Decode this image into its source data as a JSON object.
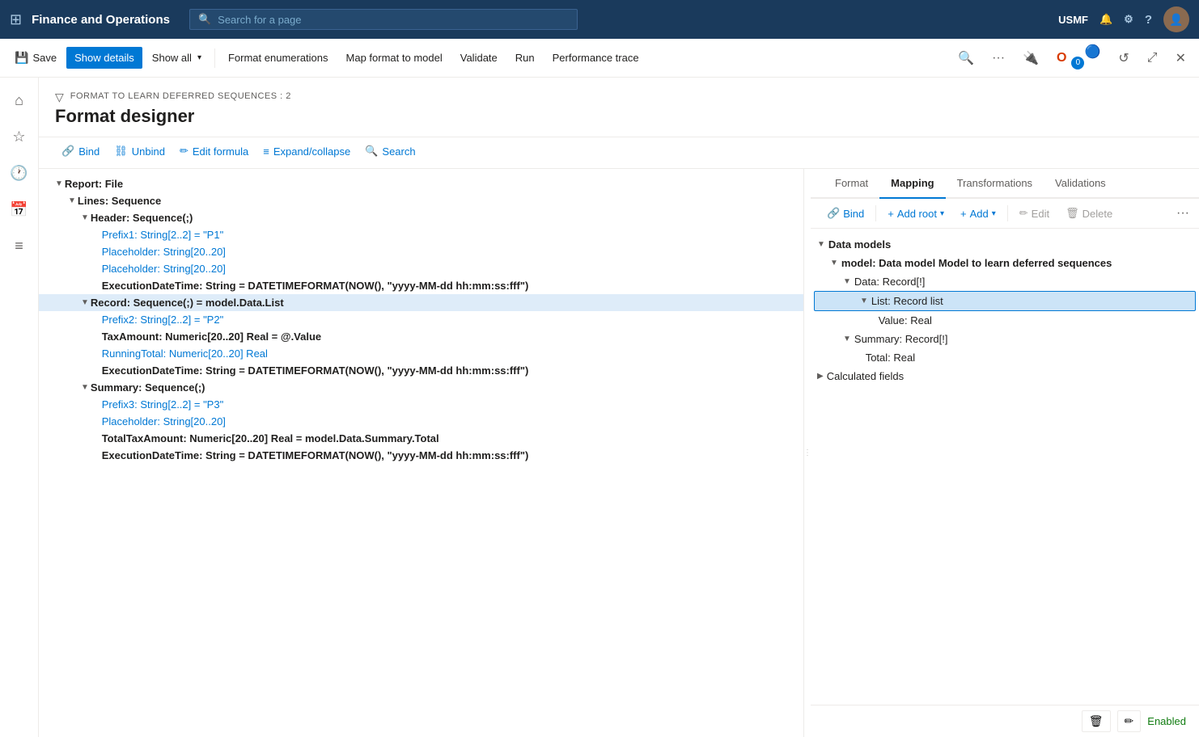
{
  "app": {
    "title": "Finance and Operations",
    "search_placeholder": "Search for a page",
    "user_code": "USMF"
  },
  "command_bar": {
    "save_label": "Save",
    "show_details_label": "Show details",
    "show_all_label": "Show all",
    "format_enumerations_label": "Format enumerations",
    "map_format_to_model_label": "Map format to model",
    "validate_label": "Validate",
    "run_label": "Run",
    "performance_trace_label": "Performance trace"
  },
  "page": {
    "breadcrumb": "FORMAT TO LEARN DEFERRED SEQUENCES : 2",
    "title": "Format designer"
  },
  "designer_toolbar": {
    "bind_label": "Bind",
    "unbind_label": "Unbind",
    "edit_formula_label": "Edit formula",
    "expand_collapse_label": "Expand/collapse",
    "search_label": "Search"
  },
  "right_tabs": {
    "format_label": "Format",
    "mapping_label": "Mapping",
    "transformations_label": "Transformations",
    "validations_label": "Validations"
  },
  "right_toolbar": {
    "bind_label": "Bind",
    "add_root_label": "Add root",
    "add_label": "Add",
    "edit_label": "Edit",
    "delete_label": "Delete"
  },
  "left_tree": {
    "items": [
      {
        "id": "report",
        "level": 1,
        "text": "Report: File",
        "type": "normal",
        "expanded": true,
        "indent": 1
      },
      {
        "id": "lines",
        "level": 2,
        "text": "Lines: Sequence",
        "type": "normal",
        "expanded": true,
        "indent": 2
      },
      {
        "id": "header",
        "level": 3,
        "text": "Header: Sequence(;)",
        "type": "normal",
        "expanded": true,
        "indent": 3
      },
      {
        "id": "prefix1",
        "level": 4,
        "text": "Prefix1: String[2..2] = \"P1\"",
        "type": "light",
        "indent": 4
      },
      {
        "id": "placeholder1",
        "level": 4,
        "text": "Placeholder: String[20..20]",
        "type": "light",
        "indent": 4
      },
      {
        "id": "placeholder2",
        "level": 4,
        "text": "Placeholder: String[20..20]",
        "type": "light",
        "indent": 4
      },
      {
        "id": "execdate1",
        "level": 4,
        "text": "ExecutionDateTime: String = DATETIMEFORMAT(NOW(), \"yyyy-MM-dd hh:mm:ss:fff\")",
        "type": "formula",
        "indent": 4
      },
      {
        "id": "record",
        "level": 3,
        "text": "Record: Sequence(;) = model.Data.List",
        "type": "formula",
        "selected": true,
        "indent": 3
      },
      {
        "id": "prefix2",
        "level": 4,
        "text": "Prefix2: String[2..2] = \"P2\"",
        "type": "light",
        "indent": 4
      },
      {
        "id": "taxamount",
        "level": 4,
        "text": "TaxAmount: Numeric[20..20] Real = @.Value",
        "type": "formula",
        "indent": 4
      },
      {
        "id": "runningtotal",
        "level": 4,
        "text": "RunningTotal: Numeric[20..20] Real",
        "type": "light",
        "indent": 4
      },
      {
        "id": "execdate2",
        "level": 4,
        "text": "ExecutionDateTime: String = DATETIMEFORMAT(NOW(), \"yyyy-MM-dd hh:mm:ss:fff\")",
        "type": "formula",
        "indent": 4
      },
      {
        "id": "summary",
        "level": 3,
        "text": "Summary: Sequence(;)",
        "type": "normal",
        "expanded": true,
        "indent": 3
      },
      {
        "id": "prefix3",
        "level": 4,
        "text": "Prefix3: String[2..2] = \"P3\"",
        "type": "light",
        "indent": 4
      },
      {
        "id": "placeholder3",
        "level": 4,
        "text": "Placeholder: String[20..20]",
        "type": "light",
        "indent": 4
      },
      {
        "id": "totaltax",
        "level": 4,
        "text": "TotalTaxAmount: Numeric[20..20] Real = model.Data.Summary.Total",
        "type": "formula",
        "indent": 4
      },
      {
        "id": "execdate3",
        "level": 4,
        "text": "ExecutionDateTime: String = DATETIMEFORMAT(NOW(), \"yyyy-MM-dd hh:mm:ss:fff\")",
        "type": "formula",
        "indent": 4
      }
    ]
  },
  "right_tree": {
    "items": [
      {
        "id": "data_models",
        "text": "Data models",
        "level": 1,
        "expanded": true,
        "bold": true,
        "indent": 0
      },
      {
        "id": "model",
        "text": "model: Data model Model to learn deferred sequences",
        "level": 2,
        "expanded": true,
        "bold": true,
        "indent": 1
      },
      {
        "id": "data_rec",
        "text": "Data: Record[!]",
        "level": 3,
        "expanded": true,
        "bold": false,
        "blue": false,
        "indent": 2
      },
      {
        "id": "list_rec",
        "text": "List: Record list",
        "level": 4,
        "expanded": true,
        "selected": true,
        "indent": 3
      },
      {
        "id": "value",
        "text": "Value: Real",
        "level": 5,
        "expanded": false,
        "indent": 4
      },
      {
        "id": "summary_rec",
        "text": "Summary: Record[!]",
        "level": 3,
        "expanded": true,
        "indent": 2
      },
      {
        "id": "total",
        "text": "Total: Real",
        "level": 4,
        "expanded": false,
        "indent": 3
      },
      {
        "id": "calc_fields",
        "text": "Calculated fields",
        "level": 1,
        "expanded": false,
        "bold": false,
        "indent": 0
      }
    ]
  },
  "bottom": {
    "status": "Enabled"
  },
  "icons": {
    "grid": "⊞",
    "search": "🔍",
    "home": "⌂",
    "star": "☆",
    "clock": "🕐",
    "calendar": "📅",
    "list": "≡",
    "filter": "▽",
    "save": "💾",
    "bind": "🔗",
    "unbind": "⛓",
    "edit": "✏",
    "expand": "≡",
    "search2": "🔍",
    "add": "+",
    "delete": "🗑",
    "bell": "🔔",
    "gear": "⚙",
    "question": "?",
    "more": "···",
    "plugin": "🔌",
    "office": "O",
    "refresh": "↺",
    "maximize": "⤢",
    "close": "✕",
    "trash": "🗑",
    "pencil": "✏"
  }
}
